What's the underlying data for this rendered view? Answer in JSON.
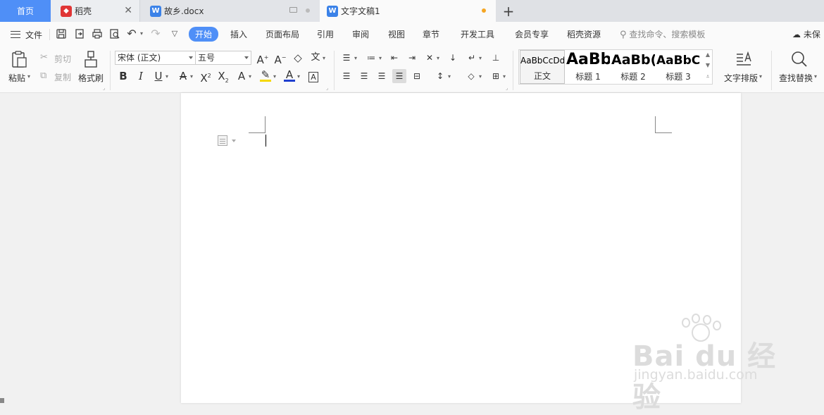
{
  "tabs": {
    "home": "首页",
    "daoke": "稻壳",
    "doc": "故乡.docx",
    "active": "文字文稿1"
  },
  "menu": {
    "file": "文件",
    "tabs": [
      "开始",
      "插入",
      "页面布局",
      "引用",
      "审阅",
      "视图",
      "章节",
      "开发工具",
      "会员专享",
      "稻壳资源"
    ],
    "search_placeholder": "查找命令、搜索模板",
    "cloud": "未保"
  },
  "ribbon": {
    "paste": "粘贴",
    "cut": "剪切",
    "copy": "复制",
    "format_painter": "格式刷",
    "font_name": "宋体 (正文)",
    "font_size": "五号",
    "styles": [
      {
        "preview": "AaBbCcDd",
        "label": "正文"
      },
      {
        "preview": "AaBb",
        "label": "标题 1"
      },
      {
        "preview": "AaBb(",
        "label": "标题 2"
      },
      {
        "preview": "AaBbC",
        "label": "标题 3"
      }
    ],
    "text_layout": "文字排版",
    "find_replace": "查找替换"
  },
  "watermark": {
    "brand": "Bai du 经验",
    "url": "jingyan.baidu.com"
  },
  "colors": {
    "accent": "#4f8ff7",
    "unsaved_dot": "#f5a623",
    "font_color_bar": "#1f3fcf",
    "highlight_bar": "#f5d800"
  }
}
